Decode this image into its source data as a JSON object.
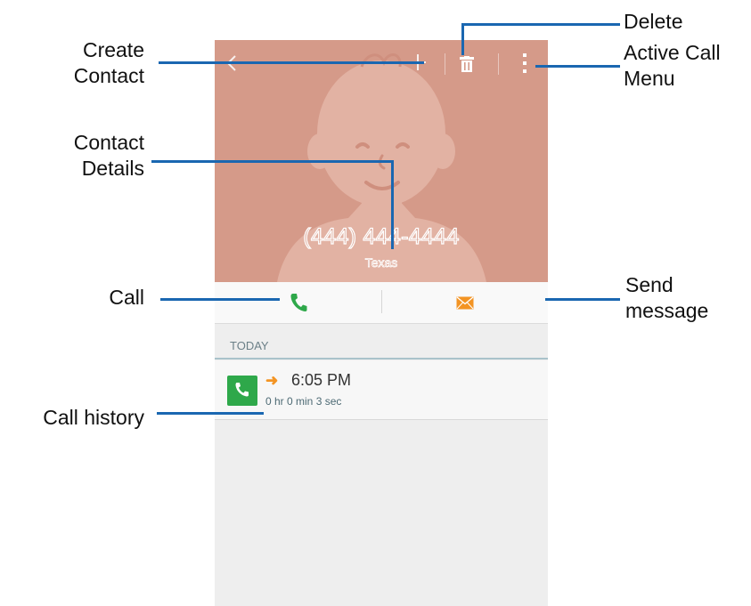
{
  "action_bar": {
    "back_icon": "chevron-left-icon",
    "create_icon": "plus-icon",
    "delete_icon": "trash-icon",
    "menu_icon": "more-vert-icon"
  },
  "contact": {
    "phone": "(444) 444-4444",
    "location": "Texas",
    "avatar_color": "#d59a89"
  },
  "actions": {
    "call_icon": "phone-icon",
    "message_icon": "envelope-icon",
    "call_color": "#2ea84a",
    "message_color": "#f39423"
  },
  "history": {
    "section_label": "TODAY",
    "items": [
      {
        "icon": "phone-icon",
        "direction_icon": "outgoing-arrow-icon",
        "time": "6:05 PM",
        "duration": "0 hr 0 min 3 sec"
      }
    ]
  },
  "callouts": {
    "create_contact": "Create\nContact",
    "contact_details": "Contact\nDetails",
    "call": "Call",
    "call_history": "Call history",
    "delete": "Delete",
    "active_call_menu": "Active Call\nMenu",
    "send_message": "Send\nmessage"
  }
}
